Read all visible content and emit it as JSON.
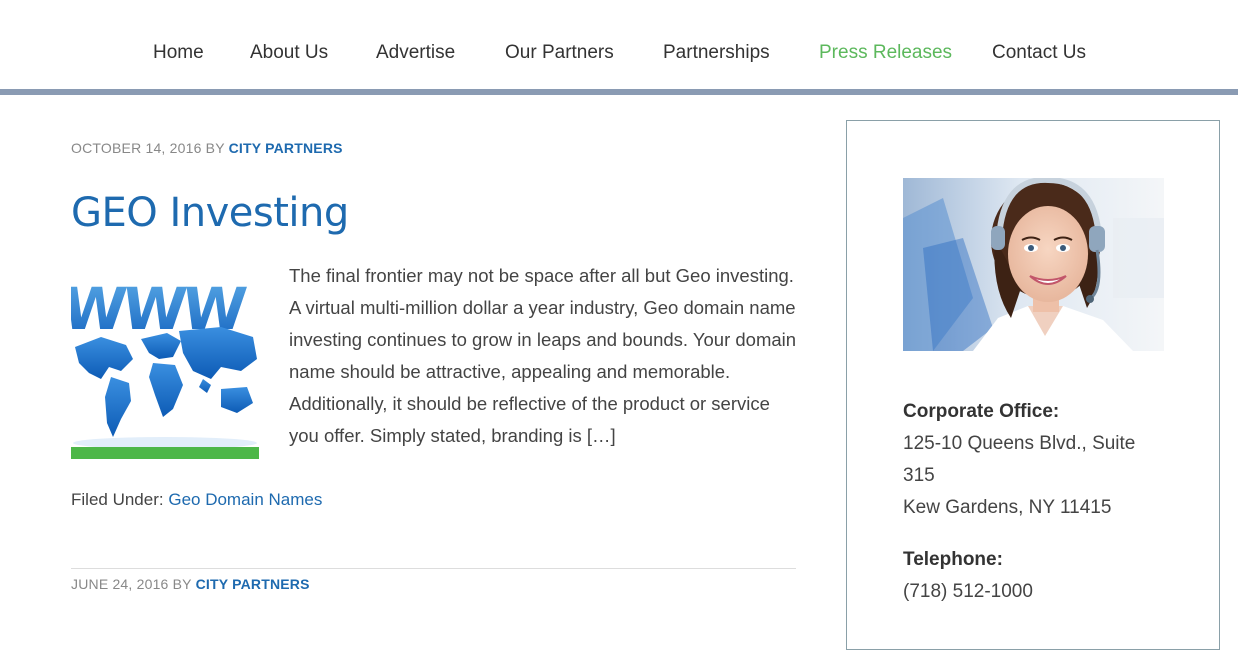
{
  "nav": {
    "items": [
      {
        "label": "Home",
        "active": false
      },
      {
        "label": "About Us",
        "active": false
      },
      {
        "label": "Advertise",
        "active": false
      },
      {
        "label": "Our Partners",
        "active": false
      },
      {
        "label": "Partnerships",
        "active": false
      },
      {
        "label": "Press Releases",
        "active": true
      },
      {
        "label": "Contact Us",
        "active": false
      }
    ],
    "bar_color": "#8a9bb3",
    "active_color": "#5cb85c"
  },
  "post1": {
    "date": "OCTOBER 14, 2016",
    "by": "BY",
    "author": "CITY PARTNERS",
    "title": "GEO Investing",
    "thumbnail_icon": "www-world-map-image",
    "excerpt": "The final frontier may not be space after all but Geo investing. A virtual multi-million dollar a year industry, Geo domain name investing continues to grow in leaps and bounds. Your domain name should be attractive, appealing and memorable. Additionally, it should be reflective of the product or service you offer. Simply stated, branding is […]",
    "filed_label": "Filed Under:",
    "category": "Geo Domain Names"
  },
  "post2": {
    "date": "JUNE 24, 2016",
    "by": "BY",
    "author": "CITY PARTNERS"
  },
  "sidebar": {
    "photo_icon": "support-agent-photo",
    "office_label": "Corporate Office:",
    "address_line1": "125-10 Queens Blvd., Suite",
    "address_line2": "315",
    "address_line3": "Kew Gardens, NY 11415",
    "phone_label": "Telephone:",
    "phone": "(718) 512-1000"
  },
  "colors": {
    "link": "#1e6aaf",
    "thumb_bar": "#4db748"
  }
}
